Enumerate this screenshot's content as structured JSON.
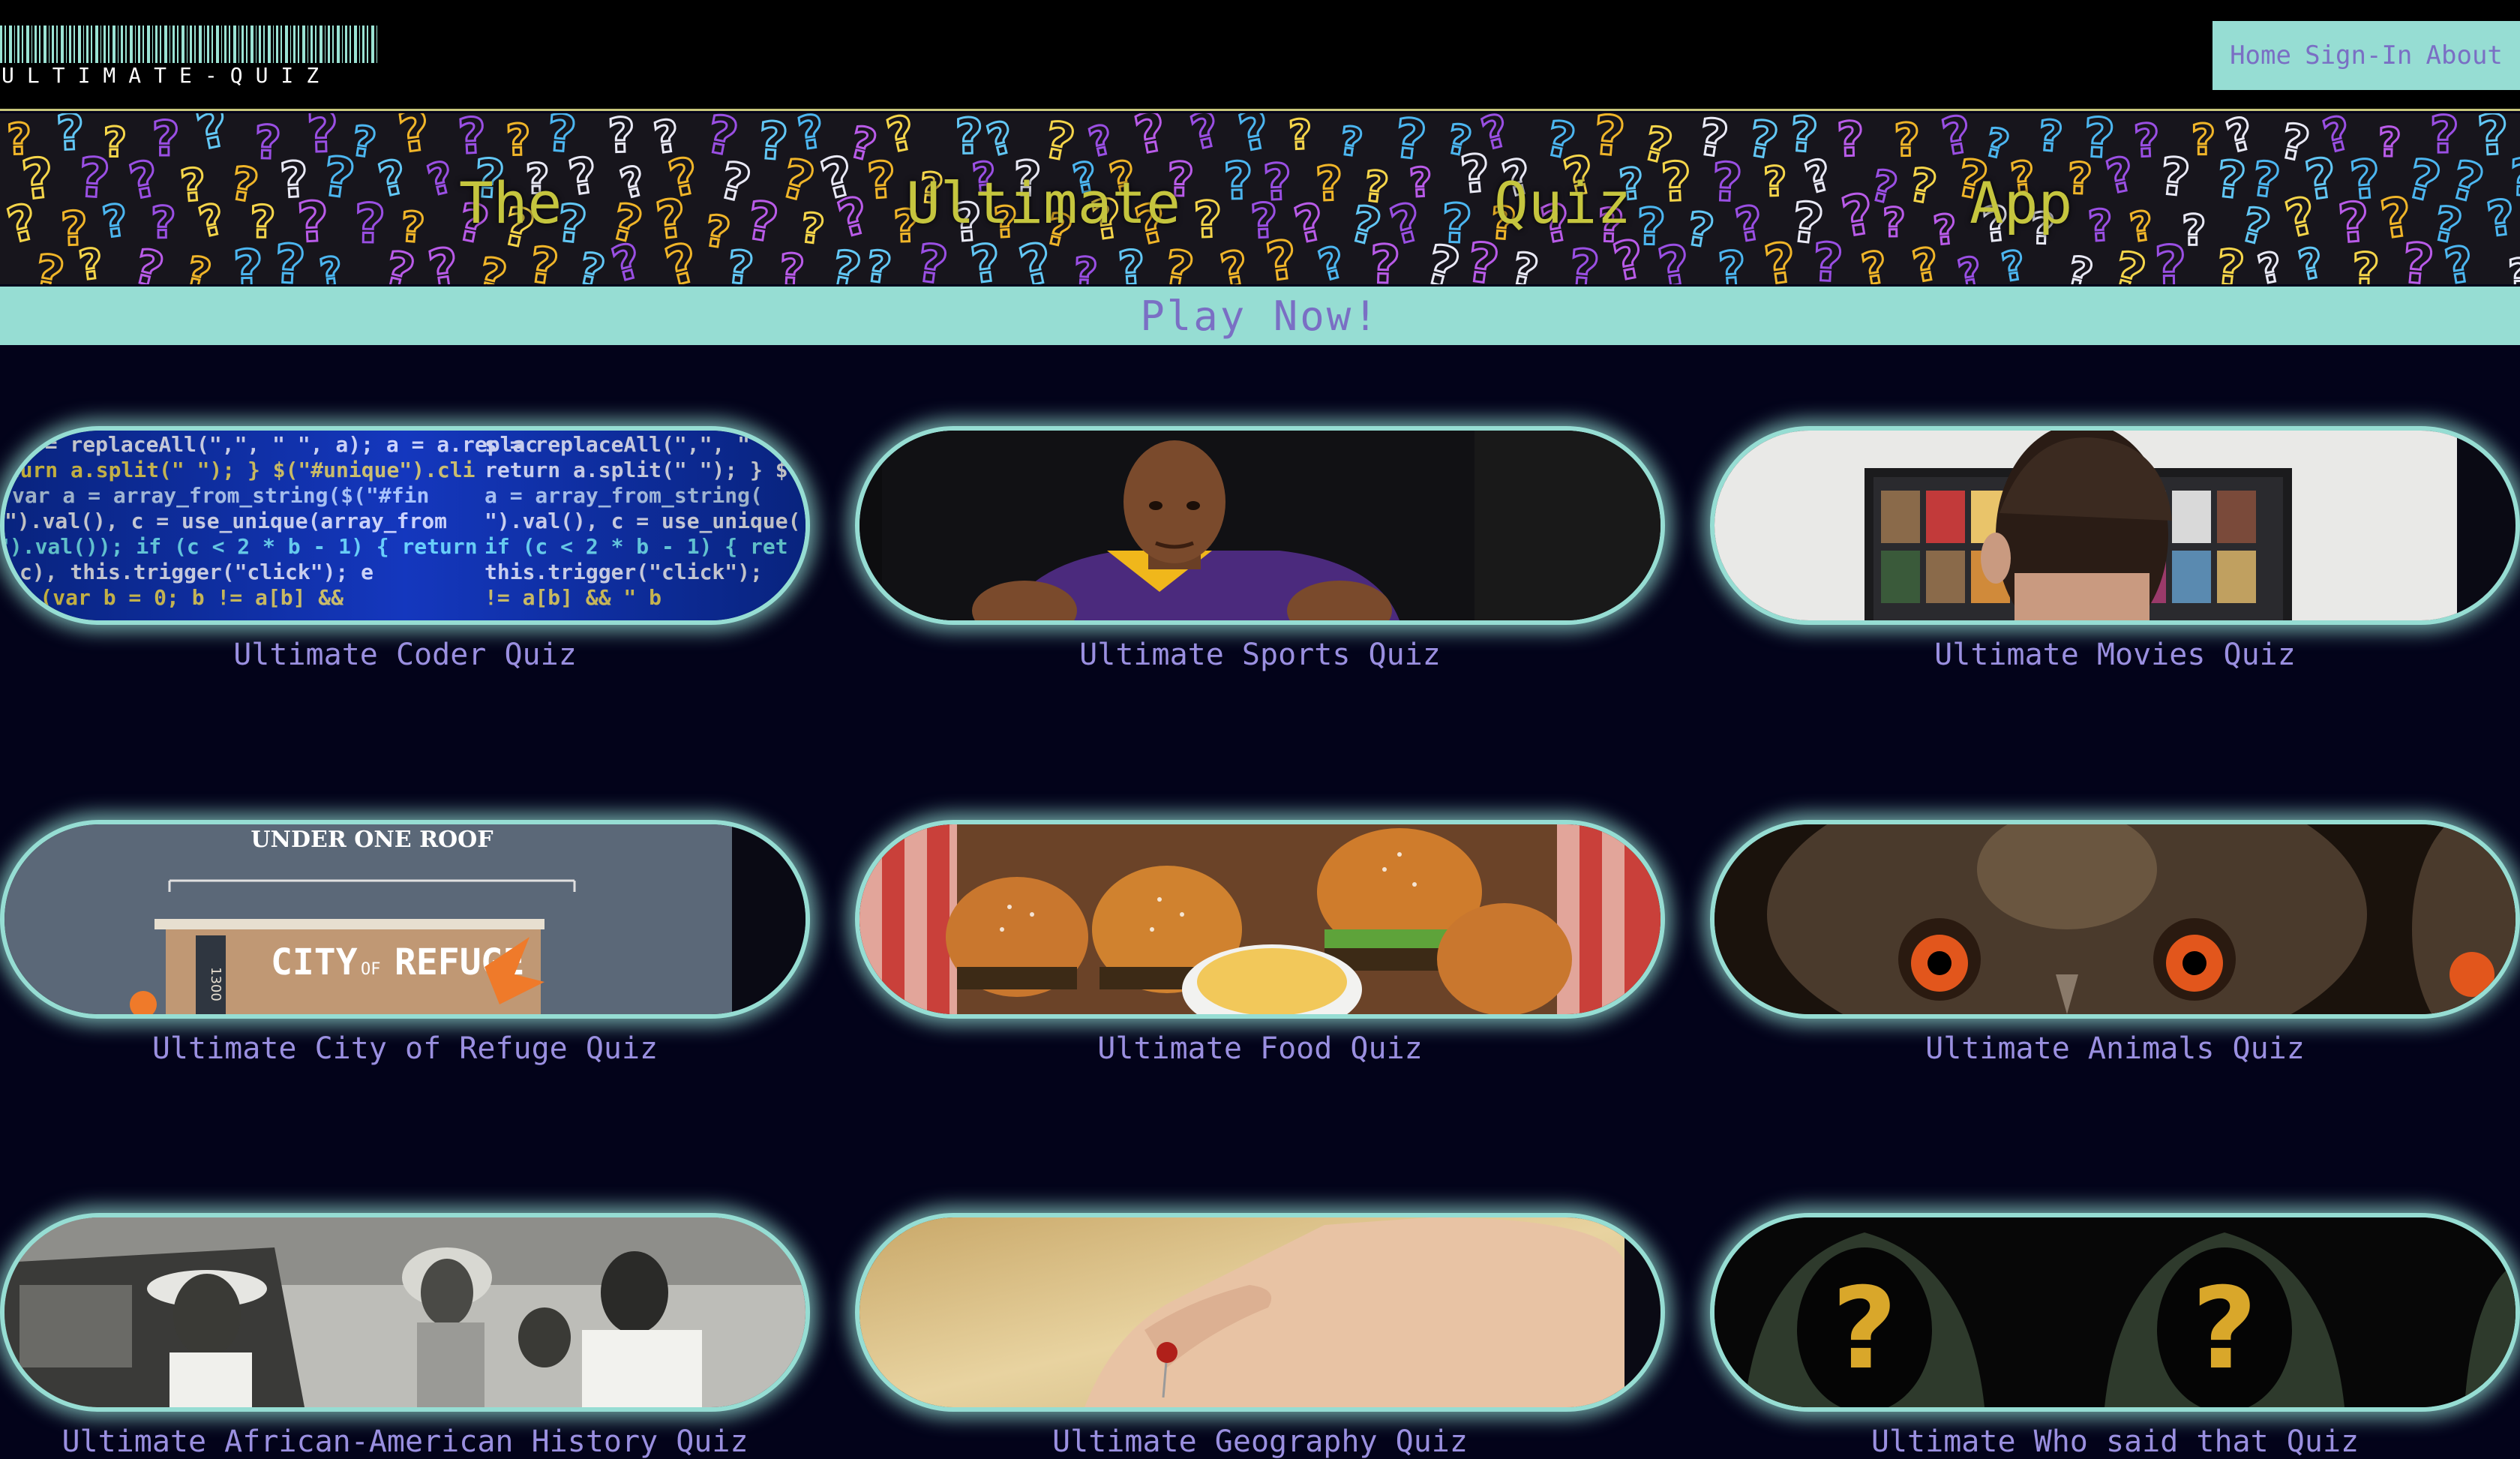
{
  "header": {
    "logo_text": "ULTIMATE-QUIZ",
    "nav": {
      "home": "Home",
      "signin": "Sign-In",
      "about": "About"
    }
  },
  "hero": {
    "words": [
      "The",
      "Ultimate",
      "Quiz",
      "App"
    ]
  },
  "play_now": "Play Now!",
  "quizzes": [
    {
      "title": "Ultimate Coder Quiz"
    },
    {
      "title": "Ultimate Sports Quiz"
    },
    {
      "title": "Ultimate Movies Quiz"
    },
    {
      "title": "Ultimate City of Refuge Quiz",
      "image_text": {
        "banner": "UNDER ONE ROOF",
        "sign_city": "CITY",
        "sign_of": "OF",
        "sign_refuge": "REFUGE",
        "number": "1300"
      }
    },
    {
      "title": "Ultimate Food Quiz"
    },
    {
      "title": "Ultimate Animals Quiz"
    },
    {
      "title": "Ultimate African-American History Quiz"
    },
    {
      "title": "Ultimate Geography Quiz"
    },
    {
      "title": "Ultimate Who said that Quiz"
    }
  ],
  "colors": {
    "accent_teal": "#96ddd3",
    "link_purple": "#7a6fc4",
    "card_title": "#9a8fe0",
    "hero_text": "#c5c53e",
    "page_bg": "#03031a"
  }
}
